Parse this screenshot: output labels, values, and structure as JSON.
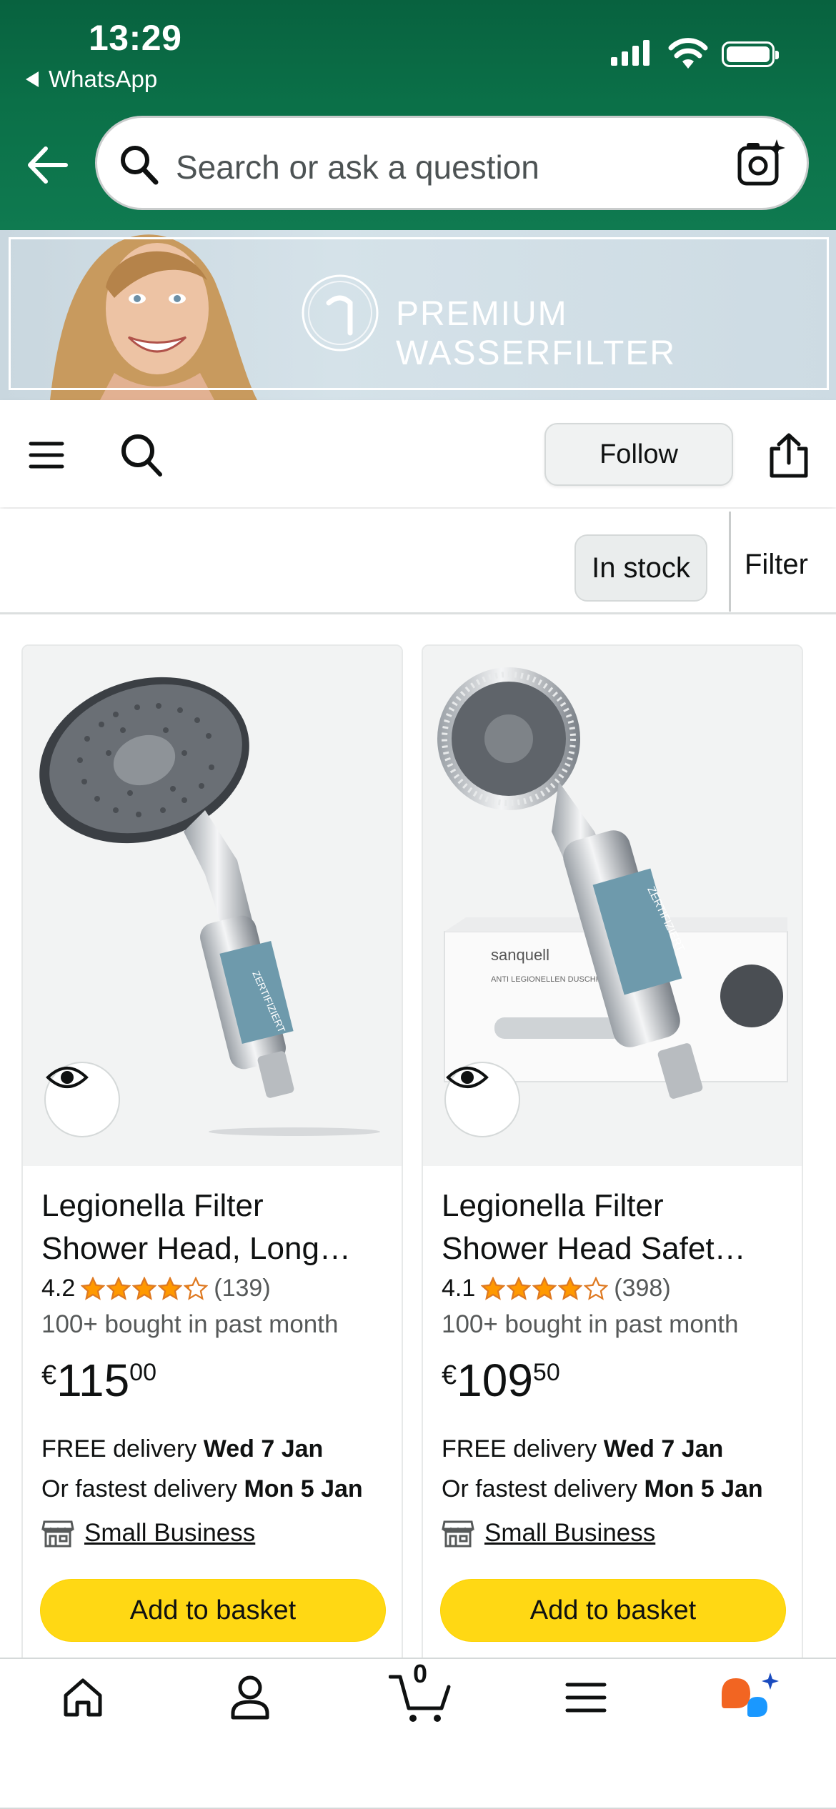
{
  "status_bar": {
    "time": "13:29",
    "back_app": "WhatsApp"
  },
  "search": {
    "placeholder": "Search or ask a question",
    "back_icon": "arrow-left-icon",
    "search_icon": "search-icon",
    "camera_icon": "camera-icon"
  },
  "banner": {
    "text": "PREMIUM WASSERFILTER"
  },
  "store_toolbar": {
    "follow_label": "Follow"
  },
  "filters": {
    "chip_in_stock": "In stock",
    "filter_label": "Filter"
  },
  "products": [
    {
      "title_line1": "Legionella Filter",
      "title_line2": "Shower Head, Long…",
      "rating": "4.2",
      "rating_stars": 4.2,
      "reviews": "(139)",
      "bought": "100+ bought in past month",
      "price_currency": "€",
      "price_whole": "115",
      "price_fraction": "00",
      "delivery_prefix": "FREE delivery",
      "delivery_date": "Wed 7 Jan",
      "fastest_prefix": "Or fastest delivery",
      "fastest_date": "Mon 5 Jan",
      "badge": "Small Business",
      "button": "Add to basket"
    },
    {
      "title_line1": "Legionella Filter",
      "title_line2": "Shower Head Safet…",
      "rating": "4.1",
      "rating_stars": 4.1,
      "reviews": "(398)",
      "bought": "100+ bought in past month",
      "price_currency": "€",
      "price_whole": "109",
      "price_fraction": "50",
      "delivery_prefix": "FREE delivery",
      "delivery_date": "Wed 7 Jan",
      "fastest_prefix": "Or fastest delivery",
      "fastest_date": "Mon 5 Jan",
      "badge": "Small Business",
      "button": "Add to basket"
    }
  ],
  "bottom_nav": {
    "cart_count": "0"
  },
  "colors": {
    "header_green": "#0b7048",
    "star_orange": "#ff9900",
    "button_yellow": "#ffd814"
  }
}
